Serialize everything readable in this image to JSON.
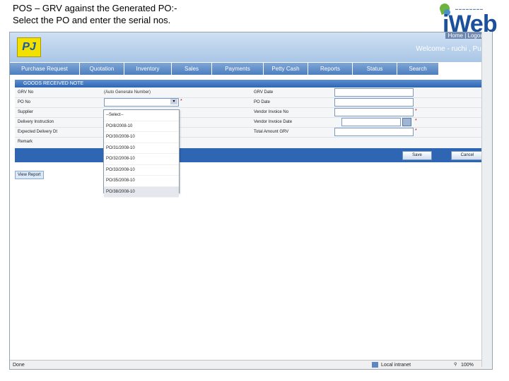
{
  "slide": {
    "title_line1": "POS – GRV against the Generated PO:-",
    "title_line2": "Select the PO and enter the serial nos."
  },
  "branding": {
    "logo_text": "iWeb",
    "app_logo": "PJ"
  },
  "header": {
    "home_links": "Home | Logout",
    "welcome": "Welcome - ruchi , Pune"
  },
  "nav": {
    "items": [
      {
        "label": "Purchase Request"
      },
      {
        "label": "Quotation"
      },
      {
        "label": "Inventory"
      },
      {
        "label": "Sales"
      },
      {
        "label": "Payments"
      },
      {
        "label": "Petty Cash"
      },
      {
        "label": "Reports"
      },
      {
        "label": "Status"
      },
      {
        "label": "Search"
      }
    ]
  },
  "form": {
    "section_title": "GOODS RECEIVED NOTE",
    "left_labels": [
      "GRV No",
      "PO No",
      "Supplier",
      "Delivery Instruction",
      "Expected Delivery Dt",
      "Remark"
    ],
    "grv_no_value": "(Auto Generate Number)",
    "right_labels": [
      "GRV Date",
      "PO Date",
      "Vendor Invoice No",
      "Vendor Invoice Date",
      "Total Amount GRV"
    ],
    "save_label": "Save",
    "cancel_label": "Cancel",
    "view_report_label": "View Report"
  },
  "po_dropdown": {
    "options": [
      "--Select--",
      "PO/8/2008-10",
      "PO/30/2008-10",
      "PO/31/2008-10",
      "PO/32/2008-10",
      "PO/33/2008-10",
      "PO/35/2008-10",
      "PO/38/2008-10"
    ]
  },
  "statusbar": {
    "left": "Done",
    "zone": "Local intranet",
    "zoom": "100%"
  }
}
